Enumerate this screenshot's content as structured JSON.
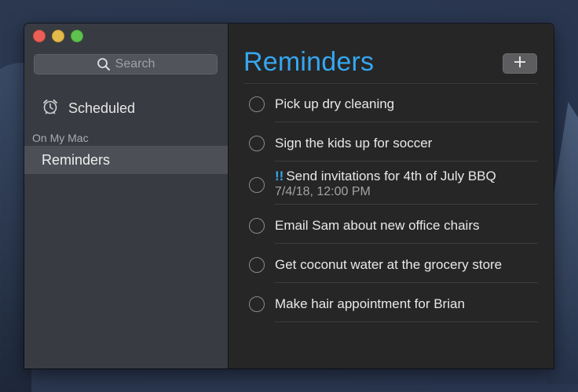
{
  "window": {
    "controls": [
      "close",
      "minimize",
      "zoom"
    ]
  },
  "sidebar": {
    "search_placeholder": "Search",
    "search_icon": "search-icon",
    "scheduled": {
      "label": "Scheduled",
      "icon": "alarm-clock-icon"
    },
    "section_label": "On My Mac",
    "lists": [
      {
        "label": "Reminders",
        "selected": true
      }
    ]
  },
  "main": {
    "title": "Reminders",
    "add_button_icon": "plus-icon",
    "accent_color": "#35a7f0",
    "reminders": [
      {
        "text": "Pick up dry cleaning",
        "priority": "",
        "due": "",
        "completed": false
      },
      {
        "text": "Sign the kids up for soccer",
        "priority": "",
        "due": "",
        "completed": false
      },
      {
        "text": "Send invitations for 4th of July BBQ",
        "priority": "!!",
        "due": "7/4/18, 12:00 PM",
        "completed": false
      },
      {
        "text": "Email Sam about new office chairs",
        "priority": "",
        "due": "",
        "completed": false
      },
      {
        "text": "Get coconut water at the grocery store",
        "priority": "",
        "due": "",
        "completed": false
      },
      {
        "text": "Make hair appointment for Brian",
        "priority": "",
        "due": "",
        "completed": false
      }
    ]
  }
}
